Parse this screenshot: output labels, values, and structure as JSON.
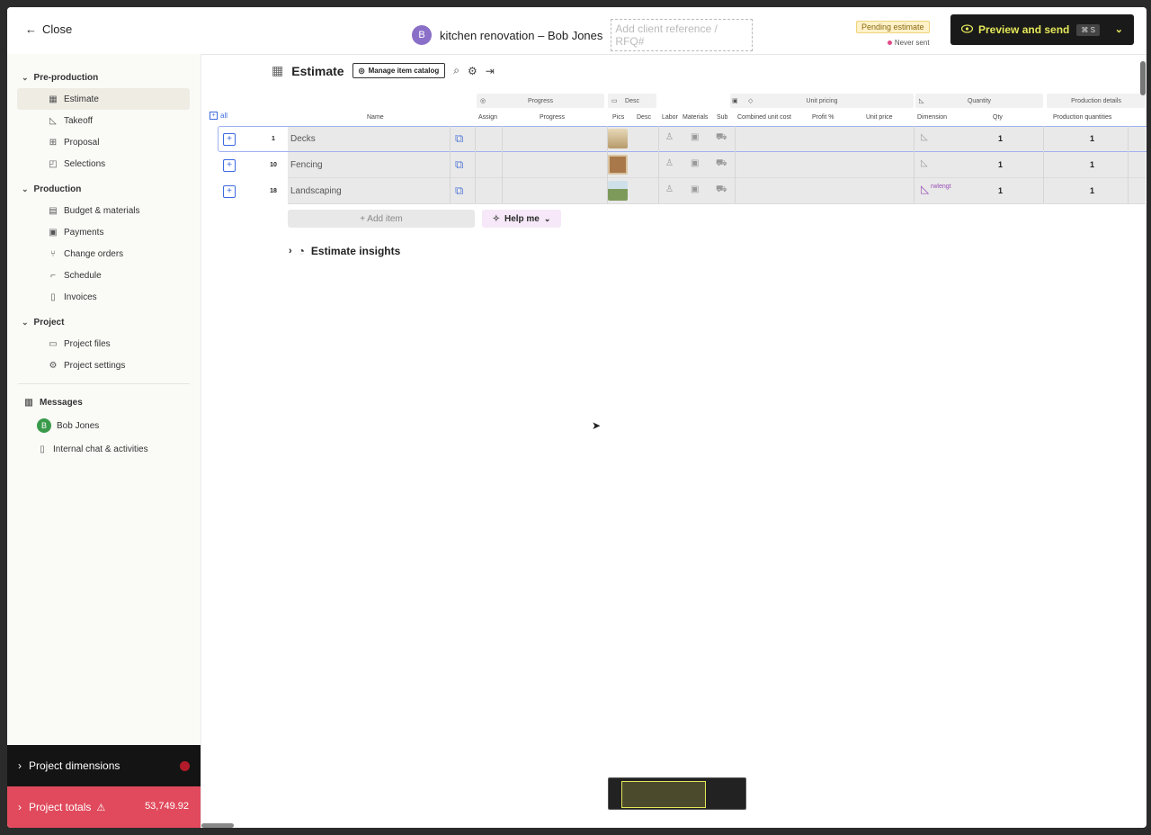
{
  "topbar": {
    "close_label": "Close",
    "project_initial": "B",
    "project_title": "kitchen renovation – Bob Jones",
    "client_ref_placeholder": "Add client reference / RFQ#",
    "status_badge": "Pending estimate",
    "status_sub": "Never sent",
    "preview_label": "Preview and send",
    "preview_shortcut": "⌘ S"
  },
  "sidebar": {
    "sections": [
      {
        "title": "Pre-production",
        "items": [
          {
            "label": "Estimate",
            "icon": "table-icon",
            "active": true
          },
          {
            "label": "Takeoff",
            "icon": "ruler-icon"
          },
          {
            "label": "Proposal",
            "icon": "proposal-icon"
          },
          {
            "label": "Selections",
            "icon": "selections-icon"
          }
        ]
      },
      {
        "title": "Production",
        "items": [
          {
            "label": "Budget & materials",
            "icon": "budget-icon"
          },
          {
            "label": "Payments",
            "icon": "payments-icon"
          },
          {
            "label": "Change orders",
            "icon": "change-orders-icon"
          },
          {
            "label": "Schedule",
            "icon": "schedule-icon"
          },
          {
            "label": "Invoices",
            "icon": "invoice-icon"
          }
        ]
      },
      {
        "title": "Project",
        "items": [
          {
            "label": "Project files",
            "icon": "folder-icon"
          },
          {
            "label": "Project settings",
            "icon": "gear-icon"
          }
        ]
      }
    ],
    "messages_title": "Messages",
    "messages": [
      {
        "label": "Bob Jones",
        "initial": "B"
      },
      {
        "label": "Internal chat & activities"
      }
    ],
    "dimensions_label": "Project dimensions",
    "totals_label": "Project totals",
    "totals_value": "53,749.92"
  },
  "main": {
    "title": "Estimate",
    "catalog_button": "Manage item catalog",
    "all_label": "all",
    "group_headers": [
      "Progress",
      "Desc",
      "Unit pricing",
      "Quantity",
      "Production details"
    ],
    "columns": [
      "Name",
      "Assign",
      "Progress",
      "Pics",
      "Desc",
      "Labor",
      "Materials",
      "Sub",
      "Combined unit cost",
      "Profit %",
      "Unit price",
      "Dimension",
      "Qty",
      "Production quantities"
    ],
    "rows": [
      {
        "num": "1",
        "name": "Decks",
        "qty": "1",
        "prod_qty": "1",
        "dimension_text": ""
      },
      {
        "num": "10",
        "name": "Fencing",
        "qty": "1",
        "prod_qty": "1",
        "dimension_text": ""
      },
      {
        "num": "18",
        "name": "Landscaping",
        "qty": "1",
        "prod_qty": "1",
        "dimension_text": "rwlengt"
      }
    ],
    "add_item_label": "+ Add item",
    "help_label": "Help me",
    "insights_label": "Estimate insights"
  }
}
